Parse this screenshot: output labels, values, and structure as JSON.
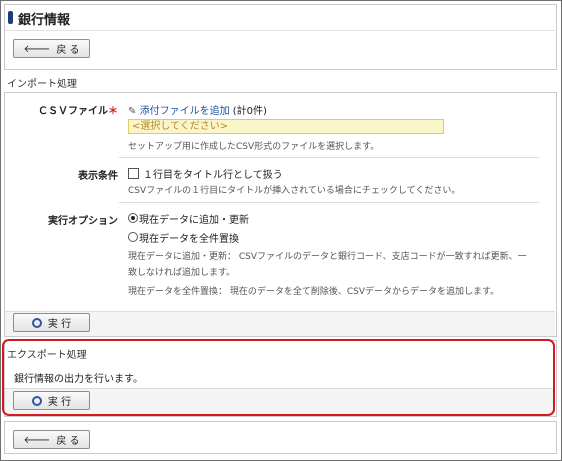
{
  "header": {
    "title": "銀行情報",
    "back_label": "戻 る"
  },
  "import_section": {
    "label": "インポート処理",
    "csv": {
      "label": "ＣＳＶファイル",
      "required_mark": "＊",
      "attach_link": "添付ファイルを追加",
      "count": "(計0件)",
      "placeholder": "<選択してください>",
      "hint": "セットアップ用に作成したCSV形式のファイルを選択します。"
    },
    "display": {
      "label": "表示条件",
      "checkbox_label": "１行目をタイトル行として扱う",
      "hint": "CSVファイルの１行目にタイトルが挿入されている場合にチェックしてください。"
    },
    "execution": {
      "label": "実行オプション",
      "option1": "現在データに追加・更新",
      "option2": "現在データを全件置換",
      "hint1_line1": "現在データに追加・更新： CSVファイルのデータと銀行コード、支店コードが一致すれば更新、一",
      "hint1_line2": "致しなければ追加します。",
      "hint2": "現在データを全件置換： 現在のデータを全て削除後、CSVデータからデータを追加します。",
      "selected": "option1"
    },
    "run_label": "実 行"
  },
  "export_section": {
    "label": "エクスポート処理",
    "description": "銀行情報の出力を行います。",
    "run_label": "実 行"
  },
  "footer": {
    "back_label": "戻 る"
  },
  "colors": {
    "accent": "#1f3c7a",
    "highlight": "#d7191f",
    "link": "#1d4fa0",
    "input_bg": "#fbf6c7"
  }
}
